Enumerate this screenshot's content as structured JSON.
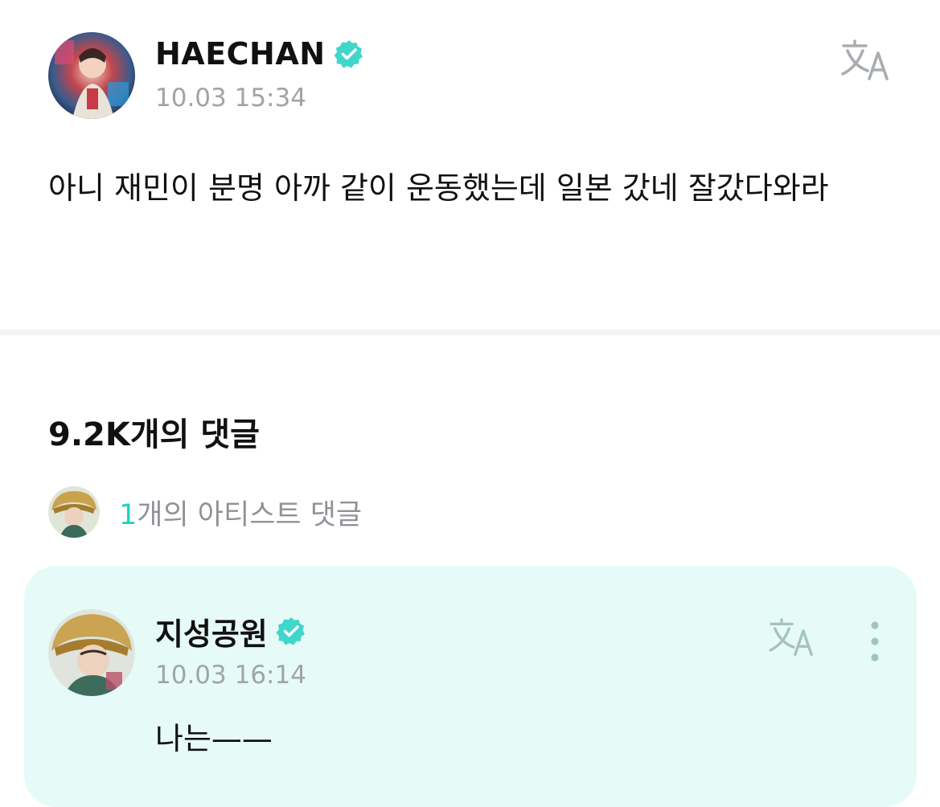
{
  "post": {
    "author": "HAECHAN",
    "verified": true,
    "timestamp": "10.03 15:34",
    "body": "아니 재민이 분명 아까 같이 운동했는데 일본 갔네 잘갔다와라",
    "translate_icon": "translate-icon",
    "avatar_icon": "avatar"
  },
  "comments": {
    "count_label": "9.2K개의 댓글",
    "artist": {
      "count": "1",
      "label": "개의 아티스트 댓글"
    },
    "items": [
      {
        "author": "지성공원",
        "verified": true,
        "timestamp": "10.03 16:14",
        "body": "나는——",
        "translate_icon": "translate-icon",
        "more_icon": "more-vertical-icon"
      }
    ]
  },
  "colors": {
    "accent": "#1fd1c5",
    "verified_badge": "#3fd6cc",
    "muted_text": "#a0a4a8",
    "comment_bg": "#e6fbf7",
    "divider": "#f3f4f5"
  }
}
